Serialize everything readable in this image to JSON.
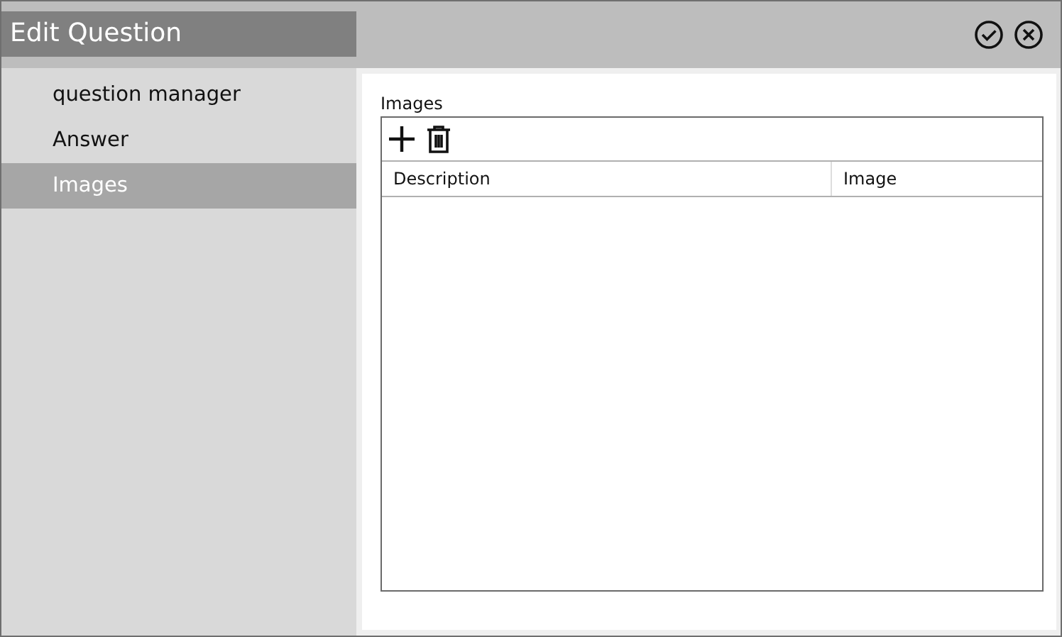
{
  "window": {
    "title": "Edit Question"
  },
  "sidebar": {
    "items": [
      {
        "label": "question manager",
        "selected": false
      },
      {
        "label": "Answer",
        "selected": false
      },
      {
        "label": "Images",
        "selected": true
      }
    ]
  },
  "images": {
    "label": "Images",
    "table": {
      "columns": [
        "Description",
        "Image"
      ]
    }
  }
}
